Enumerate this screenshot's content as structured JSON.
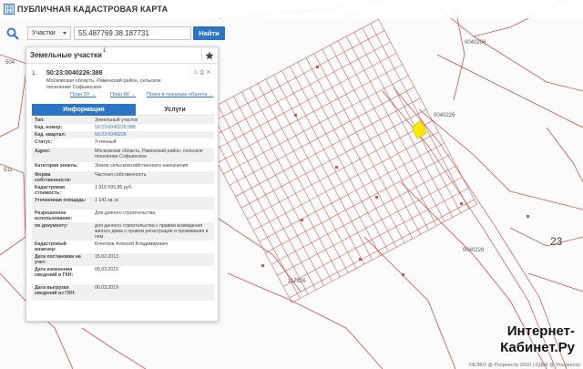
{
  "header": {
    "app_title": "ПУБЛИЧНАЯ КАДАСТРОВАЯ КАРТА"
  },
  "search": {
    "category": "Участки",
    "query": "55.487769 38.187731",
    "find_label": "Найти"
  },
  "panel": {
    "title": "Земельные участки",
    "count": "1",
    "result": {
      "index": "1.",
      "cad_number": "50:23:0040226:388",
      "address": "Московская область, Раменский район, сельское поселение Софьинское",
      "links": [
        "План ЗУ →",
        "План КК →",
        "Поиск в границах объекта →"
      ],
      "tabs": [
        "Информация",
        "Услуги"
      ],
      "properties": [
        {
          "k": "Тип:",
          "v": "Земельный участок"
        },
        {
          "k": "Кад. номер:",
          "v": "50:23:0040226:388",
          "link": true
        },
        {
          "k": "Кад. квартал:",
          "v": "50:23:0040226",
          "link": true
        },
        {
          "k": "Статус:",
          "v": "Учтенный"
        },
        {
          "k": "Адрес:",
          "v": "Московская область, Раменский район, сельское поселение Софьинское"
        },
        {
          "k": "Категория земель:",
          "v": "Земли сельскохозяйственного назначения"
        },
        {
          "k": "Форма собственности:",
          "v": "Частная собственность"
        },
        {
          "k": "Кадастровая стоимость:",
          "v": "1 810 595,85 руб."
        },
        {
          "k": "Уточненная площадь:",
          "v": "1 141 кв. м"
        },
        {
          "k": "Разрешенное использование:",
          "v": "Для дачного строительства"
        },
        {
          "k": "по документу:",
          "v": "для дачного строительства с правом возведения жилого дома с правом регистрации и проживания в нем"
        },
        {
          "k": "Кадастровый инженер:",
          "v": "Кочетков Алексей Владимирович"
        },
        {
          "k": "Дата постановки на учет:",
          "v": "15.02.2013"
        },
        {
          "k": "Дата изменения сведений в ГКН:",
          "v": "05.03.2019"
        },
        {
          "k": "Дата выгрузки сведений из ГКН:",
          "v": "06.03.2019"
        }
      ]
    }
  },
  "map": {
    "labels": [
      "150499",
      "525",
      "0040206",
      "0040228",
      "23",
      "117826",
      "511",
      "504",
      "0040226"
    ],
    "copyright": "©ЕЭКО @ Росреестр 2010 | ©ДКК @ Росреестр"
  },
  "watermark": {
    "line1": "Интернет-",
    "line2": "Кабинет.Ру"
  },
  "colors": {
    "accent": "#2c74c5",
    "parcel_line": "#c0392b",
    "highlight": "#ffe900"
  }
}
